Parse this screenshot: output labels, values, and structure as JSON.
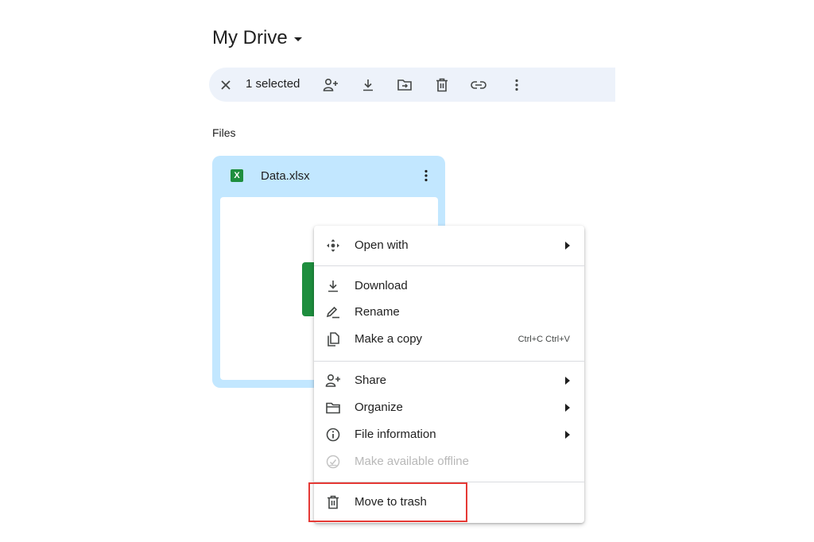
{
  "header": {
    "title": "My Drive"
  },
  "selection_bar": {
    "count_text": "1 selected",
    "actions": [
      "close-icon",
      "share-icon",
      "download-icon",
      "move-icon",
      "trash-icon",
      "link-icon",
      "more-vert-icon"
    ]
  },
  "files_section": {
    "label": "Files",
    "file": {
      "name": "Data.xlsx",
      "type_badge": "X"
    }
  },
  "context_menu": {
    "items": [
      {
        "label": "Open with",
        "icon": "open-with-icon",
        "submenu": true
      },
      {
        "label": "Download",
        "icon": "download-icon"
      },
      {
        "label": "Rename",
        "icon": "rename-icon"
      },
      {
        "label": "Make a copy",
        "icon": "copy-icon",
        "shortcut": "Ctrl+C Ctrl+V"
      },
      {
        "label": "Share",
        "icon": "share-icon",
        "submenu": true
      },
      {
        "label": "Organize",
        "icon": "folder-icon",
        "submenu": true
      },
      {
        "label": "File information",
        "icon": "info-icon",
        "submenu": true
      },
      {
        "label": "Make available offline",
        "icon": "offline-icon",
        "disabled": true
      },
      {
        "label": "Move to trash",
        "icon": "trash-icon"
      }
    ]
  },
  "colors": {
    "selection_bar_bg": "#edf2fa",
    "card_bg": "#c2e7ff",
    "excel_green": "#1e8e3e",
    "highlight_red": "#e53935"
  }
}
